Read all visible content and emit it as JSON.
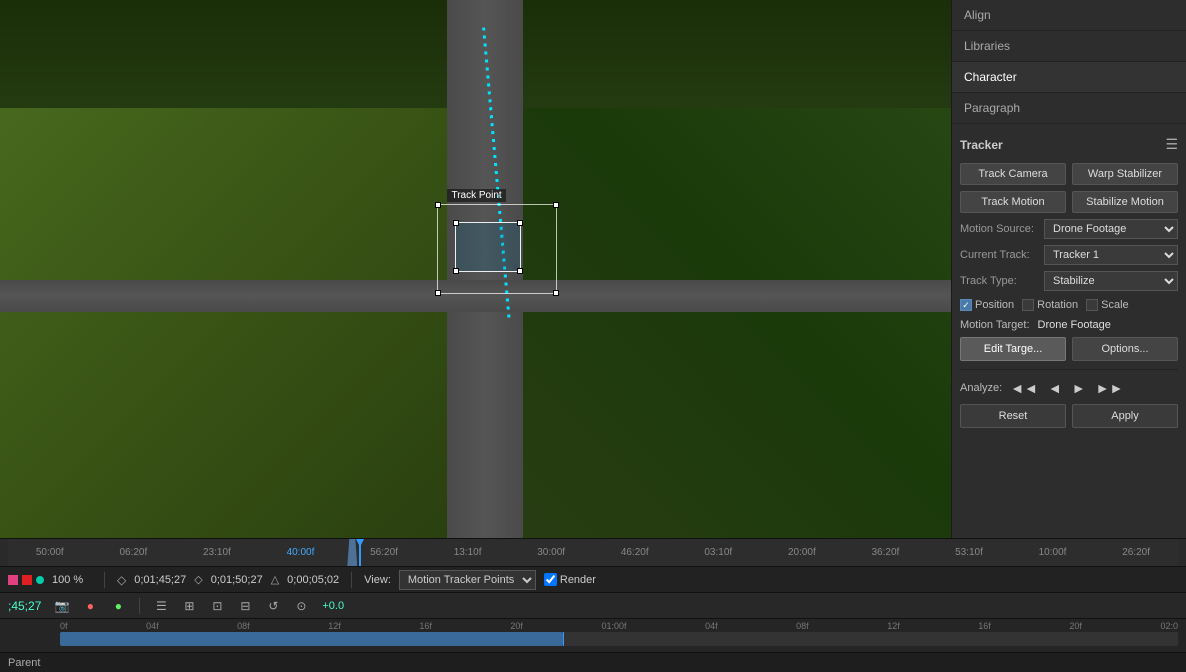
{
  "right_panel": {
    "tabs": [
      {
        "label": "Align",
        "id": "align"
      },
      {
        "label": "Libraries",
        "id": "libraries"
      },
      {
        "label": "Character",
        "id": "character"
      },
      {
        "label": "Paragraph",
        "id": "paragraph"
      }
    ],
    "tracker": {
      "title": "Tracker",
      "buttons": {
        "track_camera": "Track Camera",
        "warp_stabilizer": "Warp Stabilizer",
        "track_motion": "Track Motion",
        "stabilize_motion": "Stabilize Motion"
      },
      "motion_source_label": "Motion Source:",
      "motion_source_value": "Drone Footage",
      "current_track_label": "Current Track:",
      "current_track_value": "Tracker 1",
      "track_type_label": "Track Type:",
      "track_type_value": "Stabilize",
      "position_label": "Position",
      "rotation_label": "Rotation",
      "scale_label": "Scale",
      "motion_target_label": "Motion Target:",
      "motion_target_value": "Drone Footage",
      "edit_target_btn": "Edit Targe...",
      "options_btn": "Options...",
      "analyze_label": "Analyze:",
      "reset_btn": "Reset",
      "apply_btn": "Apply"
    }
  },
  "timeline": {
    "marks_top": [
      "50:00f",
      "06:20f",
      "23:10f",
      "40:00f",
      "56:20f",
      "13:10f",
      "30:00f",
      "46:20f",
      "03:10f",
      "20:00f",
      "36:20f",
      "53:10f",
      "10:00f",
      "26:20f"
    ],
    "marks_bottom": [
      "0f",
      "04f",
      "08f",
      "12f",
      "16f",
      "20f",
      "01:00f",
      "04f",
      "08f",
      "12f",
      "16f",
      "20f",
      "02:0"
    ]
  },
  "controls": {
    "zoom": "100 %",
    "timecode_in": "0;01;45;27",
    "timecode_out": "0;01;50;27",
    "duration": "0;00;05;02",
    "view_label": "View:",
    "view_value": "Motion Tracker Points",
    "render_label": "Render",
    "current_time": ";45;27",
    "time_offset": "+0.0"
  },
  "video": {
    "track_point_label": "Track Point"
  },
  "bottom": {
    "layer_label": "Parent"
  }
}
